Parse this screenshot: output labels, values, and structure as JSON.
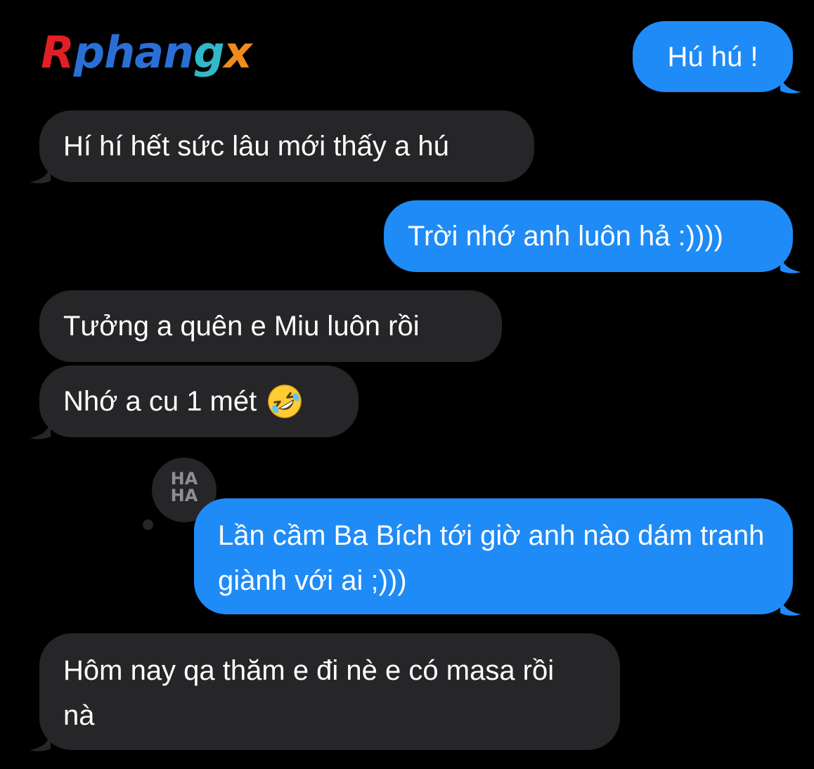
{
  "logo": {
    "part1": "R",
    "part2": "phan",
    "part3": "g",
    "part4": "x",
    "colors": [
      "#e21f26",
      "#2a6fd6",
      "#31b8c9",
      "#f08a1c"
    ]
  },
  "conversation": {
    "messages": [
      {
        "direction": "sent",
        "text": "Hú hú !"
      },
      {
        "direction": "received",
        "text": "Hí hí hết sức lâu mới thấy a hú"
      },
      {
        "direction": "sent",
        "text": "Trời nhớ anh luôn hả :))))"
      },
      {
        "direction": "received",
        "text": "Tưởng a quên e Miu luôn rồi"
      },
      {
        "direction": "received",
        "text": "Nhớ a cu 1 mét",
        "emoji": "rolling-on-floor-laughing-emoji"
      },
      {
        "direction": "sent",
        "text": "Lần cầm Ba Bích tới giờ anh nào dám tranh giành với ai ;)))",
        "reaction": {
          "line1": "HA",
          "line2": "HA"
        }
      },
      {
        "direction": "received",
        "text": "Hôm nay qa thăm e đi nè e có masa rồi nà"
      }
    ]
  },
  "colors": {
    "background": "#000000",
    "sent_bubble": "#1f8bf6",
    "received_bubble": "#262628",
    "text": "#ffffff",
    "reaction_text": "#8e8e93"
  }
}
